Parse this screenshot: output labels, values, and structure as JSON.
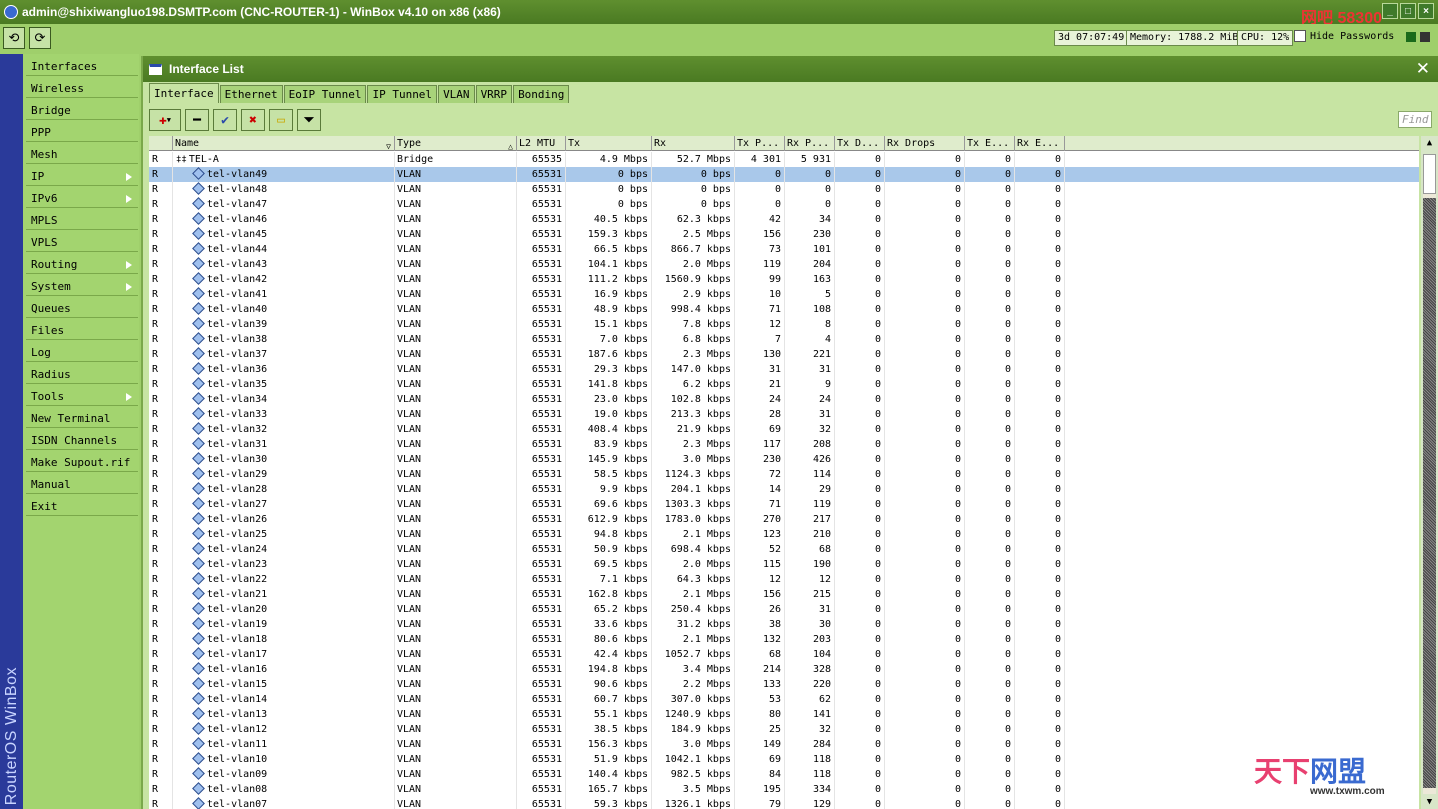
{
  "window": {
    "title": "admin@shixiwangluo198.DSMTP.com (CNC-ROUTER-1) - WinBox v4.10 on x86 (x86)",
    "logo_text": "网吧 58300"
  },
  "toolbar": {
    "undo_label": "⟲",
    "redo_label": "⟳",
    "uptime": "3d 07:07:49",
    "memory": "Memory: 1788.2 MiB",
    "cpu": "CPU: 12%",
    "hide_passwords": "Hide Passwords"
  },
  "brand": "RouterOS WinBox",
  "menu": [
    {
      "label": "Interfaces",
      "arrow": false
    },
    {
      "label": "Wireless",
      "arrow": false
    },
    {
      "label": "Bridge",
      "arrow": false
    },
    {
      "label": "PPP",
      "arrow": false
    },
    {
      "label": "Mesh",
      "arrow": false
    },
    {
      "label": "IP",
      "arrow": true
    },
    {
      "label": "IPv6",
      "arrow": true
    },
    {
      "label": "MPLS",
      "arrow": false
    },
    {
      "label": "VPLS",
      "arrow": false
    },
    {
      "label": "Routing",
      "arrow": true
    },
    {
      "label": "System",
      "arrow": true
    },
    {
      "label": "Queues",
      "arrow": false
    },
    {
      "label": "Files",
      "arrow": false
    },
    {
      "label": "Log",
      "arrow": false
    },
    {
      "label": "Radius",
      "arrow": false
    },
    {
      "label": "Tools",
      "arrow": true
    },
    {
      "label": "New Terminal",
      "arrow": false
    },
    {
      "label": "ISDN Channels",
      "arrow": false
    },
    {
      "label": "Make Supout.rif",
      "arrow": false
    },
    {
      "label": "Manual",
      "arrow": false
    },
    {
      "label": "Exit",
      "arrow": false
    }
  ],
  "interface_window": {
    "title": "Interface List",
    "tabs": [
      "Interface",
      "Ethernet",
      "EoIP Tunnel",
      "IP Tunnel",
      "VLAN",
      "VRRP",
      "Bonding"
    ],
    "active_tab": 0,
    "find_placeholder": "Find",
    "columns": [
      "",
      "Name",
      "Type",
      "L2 MTU",
      "Tx",
      "Rx",
      "Tx P...",
      "Rx P...",
      "Tx D...",
      "Rx Drops",
      "Tx E...",
      "Rx E..."
    ],
    "rows": [
      [
        "R",
        "TEL-A",
        "Bridge",
        "65535",
        "4.9 Mbps",
        "52.7 Mbps",
        "4 301",
        "5 931",
        "0",
        "0",
        "0",
        "0"
      ],
      [
        "R",
        "tel-vlan49",
        "VLAN",
        "65531",
        "0 bps",
        "0 bps",
        "0",
        "0",
        "0",
        "0",
        "0",
        "0"
      ],
      [
        "R",
        "tel-vlan48",
        "VLAN",
        "65531",
        "0 bps",
        "0 bps",
        "0",
        "0",
        "0",
        "0",
        "0",
        "0"
      ],
      [
        "R",
        "tel-vlan47",
        "VLAN",
        "65531",
        "0 bps",
        "0 bps",
        "0",
        "0",
        "0",
        "0",
        "0",
        "0"
      ],
      [
        "R",
        "tel-vlan46",
        "VLAN",
        "65531",
        "40.5 kbps",
        "62.3 kbps",
        "42",
        "34",
        "0",
        "0",
        "0",
        "0"
      ],
      [
        "R",
        "tel-vlan45",
        "VLAN",
        "65531",
        "159.3 kbps",
        "2.5 Mbps",
        "156",
        "230",
        "0",
        "0",
        "0",
        "0"
      ],
      [
        "R",
        "tel-vlan44",
        "VLAN",
        "65531",
        "66.5 kbps",
        "866.7 kbps",
        "73",
        "101",
        "0",
        "0",
        "0",
        "0"
      ],
      [
        "R",
        "tel-vlan43",
        "VLAN",
        "65531",
        "104.1 kbps",
        "2.0 Mbps",
        "119",
        "204",
        "0",
        "0",
        "0",
        "0"
      ],
      [
        "R",
        "tel-vlan42",
        "VLAN",
        "65531",
        "111.2 kbps",
        "1560.9 kbps",
        "99",
        "163",
        "0",
        "0",
        "0",
        "0"
      ],
      [
        "R",
        "tel-vlan41",
        "VLAN",
        "65531",
        "16.9 kbps",
        "2.9 kbps",
        "10",
        "5",
        "0",
        "0",
        "0",
        "0"
      ],
      [
        "R",
        "tel-vlan40",
        "VLAN",
        "65531",
        "48.9 kbps",
        "998.4 kbps",
        "71",
        "108",
        "0",
        "0",
        "0",
        "0"
      ],
      [
        "R",
        "tel-vlan39",
        "VLAN",
        "65531",
        "15.1 kbps",
        "7.8 kbps",
        "12",
        "8",
        "0",
        "0",
        "0",
        "0"
      ],
      [
        "R",
        "tel-vlan38",
        "VLAN",
        "65531",
        "7.0 kbps",
        "6.8 kbps",
        "7",
        "4",
        "0",
        "0",
        "0",
        "0"
      ],
      [
        "R",
        "tel-vlan37",
        "VLAN",
        "65531",
        "187.6 kbps",
        "2.3 Mbps",
        "130",
        "221",
        "0",
        "0",
        "0",
        "0"
      ],
      [
        "R",
        "tel-vlan36",
        "VLAN",
        "65531",
        "29.3 kbps",
        "147.0 kbps",
        "31",
        "31",
        "0",
        "0",
        "0",
        "0"
      ],
      [
        "R",
        "tel-vlan35",
        "VLAN",
        "65531",
        "141.8 kbps",
        "6.2 kbps",
        "21",
        "9",
        "0",
        "0",
        "0",
        "0"
      ],
      [
        "R",
        "tel-vlan34",
        "VLAN",
        "65531",
        "23.0 kbps",
        "102.8 kbps",
        "24",
        "24",
        "0",
        "0",
        "0",
        "0"
      ],
      [
        "R",
        "tel-vlan33",
        "VLAN",
        "65531",
        "19.0 kbps",
        "213.3 kbps",
        "28",
        "31",
        "0",
        "0",
        "0",
        "0"
      ],
      [
        "R",
        "tel-vlan32",
        "VLAN",
        "65531",
        "408.4 kbps",
        "21.9 kbps",
        "69",
        "32",
        "0",
        "0",
        "0",
        "0"
      ],
      [
        "R",
        "tel-vlan31",
        "VLAN",
        "65531",
        "83.9 kbps",
        "2.3 Mbps",
        "117",
        "208",
        "0",
        "0",
        "0",
        "0"
      ],
      [
        "R",
        "tel-vlan30",
        "VLAN",
        "65531",
        "145.9 kbps",
        "3.0 Mbps",
        "230",
        "426",
        "0",
        "0",
        "0",
        "0"
      ],
      [
        "R",
        "tel-vlan29",
        "VLAN",
        "65531",
        "58.5 kbps",
        "1124.3 kbps",
        "72",
        "114",
        "0",
        "0",
        "0",
        "0"
      ],
      [
        "R",
        "tel-vlan28",
        "VLAN",
        "65531",
        "9.9 kbps",
        "204.1 kbps",
        "14",
        "29",
        "0",
        "0",
        "0",
        "0"
      ],
      [
        "R",
        "tel-vlan27",
        "VLAN",
        "65531",
        "69.6 kbps",
        "1303.3 kbps",
        "71",
        "119",
        "0",
        "0",
        "0",
        "0"
      ],
      [
        "R",
        "tel-vlan26",
        "VLAN",
        "65531",
        "612.9 kbps",
        "1783.0 kbps",
        "270",
        "217",
        "0",
        "0",
        "0",
        "0"
      ],
      [
        "R",
        "tel-vlan25",
        "VLAN",
        "65531",
        "94.8 kbps",
        "2.1 Mbps",
        "123",
        "210",
        "0",
        "0",
        "0",
        "0"
      ],
      [
        "R",
        "tel-vlan24",
        "VLAN",
        "65531",
        "50.9 kbps",
        "698.4 kbps",
        "52",
        "68",
        "0",
        "0",
        "0",
        "0"
      ],
      [
        "R",
        "tel-vlan23",
        "VLAN",
        "65531",
        "69.5 kbps",
        "2.0 Mbps",
        "115",
        "190",
        "0",
        "0",
        "0",
        "0"
      ],
      [
        "R",
        "tel-vlan22",
        "VLAN",
        "65531",
        "7.1 kbps",
        "64.3 kbps",
        "12",
        "12",
        "0",
        "0",
        "0",
        "0"
      ],
      [
        "R",
        "tel-vlan21",
        "VLAN",
        "65531",
        "162.8 kbps",
        "2.1 Mbps",
        "156",
        "215",
        "0",
        "0",
        "0",
        "0"
      ],
      [
        "R",
        "tel-vlan20",
        "VLAN",
        "65531",
        "65.2 kbps",
        "250.4 kbps",
        "26",
        "31",
        "0",
        "0",
        "0",
        "0"
      ],
      [
        "R",
        "tel-vlan19",
        "VLAN",
        "65531",
        "33.6 kbps",
        "31.2 kbps",
        "38",
        "30",
        "0",
        "0",
        "0",
        "0"
      ],
      [
        "R",
        "tel-vlan18",
        "VLAN",
        "65531",
        "80.6 kbps",
        "2.1 Mbps",
        "132",
        "203",
        "0",
        "0",
        "0",
        "0"
      ],
      [
        "R",
        "tel-vlan17",
        "VLAN",
        "65531",
        "42.4 kbps",
        "1052.7 kbps",
        "68",
        "104",
        "0",
        "0",
        "0",
        "0"
      ],
      [
        "R",
        "tel-vlan16",
        "VLAN",
        "65531",
        "194.8 kbps",
        "3.4 Mbps",
        "214",
        "328",
        "0",
        "0",
        "0",
        "0"
      ],
      [
        "R",
        "tel-vlan15",
        "VLAN",
        "65531",
        "90.6 kbps",
        "2.2 Mbps",
        "133",
        "220",
        "0",
        "0",
        "0",
        "0"
      ],
      [
        "R",
        "tel-vlan14",
        "VLAN",
        "65531",
        "60.7 kbps",
        "307.0 kbps",
        "53",
        "62",
        "0",
        "0",
        "0",
        "0"
      ],
      [
        "R",
        "tel-vlan13",
        "VLAN",
        "65531",
        "55.1 kbps",
        "1240.9 kbps",
        "80",
        "141",
        "0",
        "0",
        "0",
        "0"
      ],
      [
        "R",
        "tel-vlan12",
        "VLAN",
        "65531",
        "38.5 kbps",
        "184.9 kbps",
        "25",
        "32",
        "0",
        "0",
        "0",
        "0"
      ],
      [
        "R",
        "tel-vlan11",
        "VLAN",
        "65531",
        "156.3 kbps",
        "3.0 Mbps",
        "149",
        "284",
        "0",
        "0",
        "0",
        "0"
      ],
      [
        "R",
        "tel-vlan10",
        "VLAN",
        "65531",
        "51.9 kbps",
        "1042.1 kbps",
        "69",
        "118",
        "0",
        "0",
        "0",
        "0"
      ],
      [
        "R",
        "tel-vlan09",
        "VLAN",
        "65531",
        "140.4 kbps",
        "982.5 kbps",
        "84",
        "118",
        "0",
        "0",
        "0",
        "0"
      ],
      [
        "R",
        "tel-vlan08",
        "VLAN",
        "65531",
        "165.7 kbps",
        "3.5 Mbps",
        "195",
        "334",
        "0",
        "0",
        "0",
        "0"
      ],
      [
        "R",
        "tel-vlan07",
        "VLAN",
        "65531",
        "59.3 kbps",
        "1326.1 kbps",
        "79",
        "129",
        "0",
        "0",
        "0",
        "0"
      ]
    ],
    "selected_row": 1
  },
  "watermark": {
    "text_a": "天下",
    "text_b": "网盟",
    "url": "www.txwm.com"
  },
  "colors": {
    "title_bar": "#4a7a22",
    "background": "#9fcf6b",
    "selected_row": "#a9c8ea",
    "brand_strip": "#2a3a9a"
  },
  "icons": {
    "vlan": "diamond-icon",
    "bridge": "bridge-icon"
  }
}
